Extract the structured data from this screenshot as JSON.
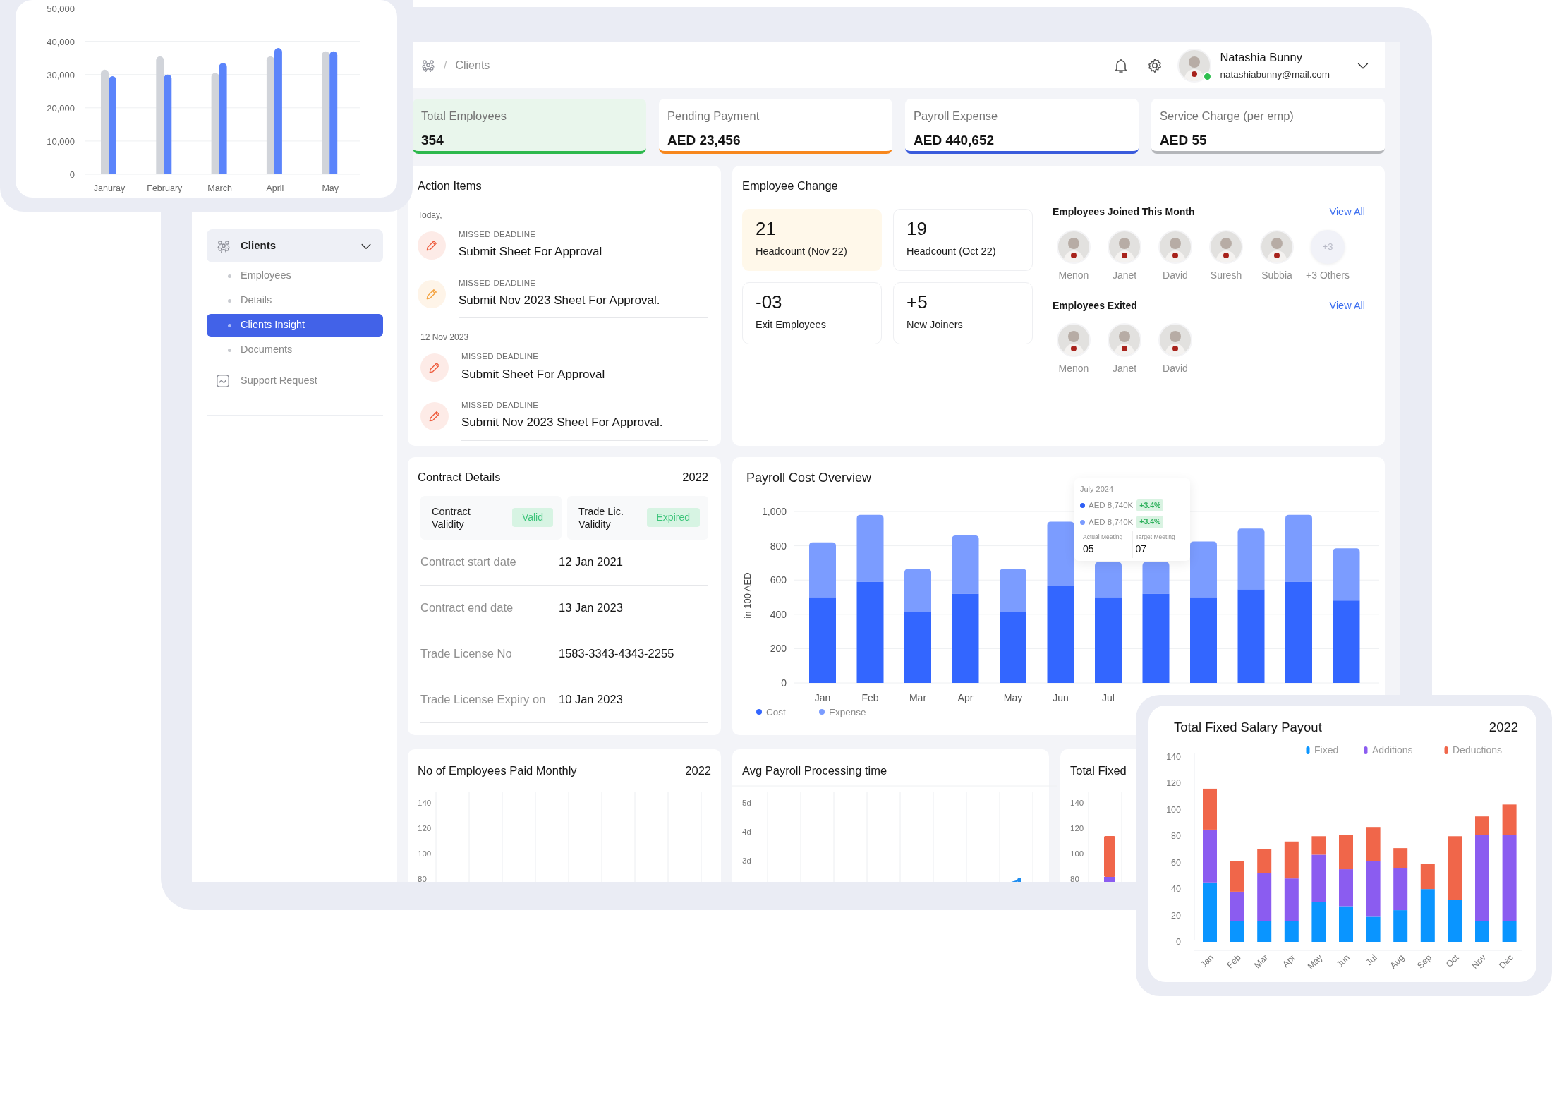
{
  "top_chart": {
    "chart_data": {
      "type": "bar",
      "categories": [
        "Januray",
        "February",
        "March",
        "April",
        "May"
      ],
      "series": [
        {
          "color": "#d1d4da",
          "values": [
            31500,
            35500,
            30500,
            35500,
            37000
          ]
        },
        {
          "color": "#5b84fb",
          "values": [
            29500,
            30000,
            33500,
            38000,
            37000
          ]
        }
      ],
      "ylim": [
        0,
        50000
      ],
      "grid": true,
      "yticks": [
        {
          "value": 0,
          "label": "0"
        },
        {
          "value": 10000,
          "label": "10,000"
        },
        {
          "value": 20000,
          "label": "20,000"
        },
        {
          "value": 30000,
          "label": "30,000"
        },
        {
          "value": 40000,
          "label": "40,000"
        },
        {
          "value": 50000,
          "label": "50,000"
        }
      ]
    }
  },
  "header": {
    "separator": "/",
    "current": "Clients",
    "user": {
      "name": "Natashia Bunny",
      "email": "natashiabunny@mail.com",
      "online": true
    }
  },
  "sidebar": {
    "items": [
      {
        "kind": "group",
        "label": "Clients",
        "expanded": true,
        "selected": false,
        "children": [
          {
            "label": "Employees",
            "selected": false
          },
          {
            "label": "Details",
            "selected": false
          },
          {
            "label": "Clients Insight",
            "selected": true
          },
          {
            "label": "Documents",
            "selected": false
          }
        ]
      },
      {
        "kind": "link",
        "label": "Support Request",
        "selected": false
      }
    ]
  },
  "stats": [
    {
      "label": "Total Employees",
      "value": "354",
      "color": "#2db84d",
      "selected": true
    },
    {
      "label": "Pending Payment",
      "value": "AED 23,456",
      "color": "#f7871d",
      "selected": false
    },
    {
      "label": "Payroll Expense",
      "value": "AED 440,652",
      "color": "#3a5bdc",
      "selected": false
    },
    {
      "label": "Service Charge (per emp)",
      "value": "AED 55",
      "color": "#b4b6ba",
      "selected": false
    }
  ],
  "action_items": {
    "title": "Action Items",
    "groups": [
      {
        "date": "Today,",
        "items": [
          {
            "tag": "MISSED DEADLINE",
            "title": "Submit Sheet For Approval",
            "color": "#ee5a3b"
          },
          {
            "tag": "MISSED DEADLINE",
            "title": "Submit Nov 2023 Sheet For Approval.",
            "color": "#f4a340"
          }
        ]
      },
      {
        "date": "12 Nov 2023",
        "items": [
          {
            "tag": "MISSED DEADLINE",
            "title": "Submit Sheet For Approval",
            "color": "#ee5a3b"
          },
          {
            "tag": "MISSED DEADLINE",
            "title": "Submit Nov 2023 Sheet For Approval.",
            "color": "#ee5a3b"
          }
        ]
      }
    ]
  },
  "employee_change": {
    "title": "Employee Change",
    "tiles": [
      {
        "value": "21",
        "label": "Headcount (Nov 22)",
        "selected": true
      },
      {
        "value": "19",
        "label": "Headcount (Oct 22)",
        "selected": false
      },
      {
        "value": "-03",
        "label": "Exit Employees",
        "selected": false
      },
      {
        "value": "+5",
        "label": "New Joiners",
        "selected": false
      }
    ],
    "joined": {
      "title": "Employees Joined This Month",
      "link": "View All",
      "people": [
        {
          "name": "Menon"
        },
        {
          "name": "Janet"
        },
        {
          "name": "David"
        },
        {
          "name": "Suresh"
        },
        {
          "name": "Subbia"
        }
      ],
      "more": {
        "count": "+3",
        "label": "+3 Others"
      }
    },
    "exited": {
      "title": "Employees Exited",
      "link": "View All",
      "people": [
        {
          "name": "Menon"
        },
        {
          "name": "Janet"
        },
        {
          "name": "David"
        }
      ]
    }
  },
  "contract": {
    "title": "Contract Details",
    "year": "2022",
    "validity": [
      {
        "label": "Contract Validity",
        "status": "Valid"
      },
      {
        "label": "Trade Lic. Validity",
        "status": "Expired"
      }
    ],
    "rows": [
      {
        "label": "Contract start date",
        "value": "12 Jan 2021"
      },
      {
        "label": "Contract end date",
        "value": "13 Jan 2023"
      },
      {
        "label": "Trade License No",
        "value": "1583-3343-4343-2255"
      },
      {
        "label": "Trade License Expiry on",
        "value": "10 Jan 2023"
      }
    ]
  },
  "payroll": {
    "title": "Payroll Cost Overview",
    "chart_data": {
      "type": "bar",
      "stacked": true,
      "ylabel": "in 100 AED",
      "categories": [
        "Jan",
        "Feb",
        "Mar",
        "Apr",
        "May",
        "Jun",
        "Jul",
        null,
        null,
        null,
        null,
        null
      ],
      "series": [
        {
          "name": "Cost",
          "color": "#3366ff",
          "values": [
            500,
            590,
            415,
            520,
            415,
            565,
            500,
            520,
            500,
            545,
            590,
            480
          ]
        },
        {
          "name": "Expense",
          "color": "#7b9cff",
          "values": [
            320,
            390,
            250,
            340,
            250,
            375,
            205,
            185,
            325,
            355,
            390,
            305
          ]
        }
      ],
      "ylim": [
        0,
        1000
      ],
      "grid": true,
      "legend": true,
      "yticks": [
        0,
        200,
        400,
        600,
        800,
        {
          "value": 1000,
          "label": "1,000"
        }
      ]
    },
    "tooltip": {
      "title": "July 2024",
      "rows": [
        {
          "value": "AED 8,740K",
          "change": "+3.4%",
          "color": "#2f5ff5"
        },
        {
          "value": "AED 8,740K",
          "change": "+3.4%",
          "color": "#7b9cff"
        }
      ],
      "stats": [
        {
          "label": "Actual Meeting",
          "value": "05"
        },
        {
          "label": "Target Meeting",
          "value": "07"
        }
      ]
    }
  },
  "bottom_cards": [
    {
      "kind": "empty",
      "title": "No of Employees Paid Monthly",
      "year": "2022",
      "y_axis_labels": [
        "140",
        "120",
        "100",
        "80"
      ]
    },
    {
      "kind": "line",
      "title": "Avg Payroll Processing time",
      "y_axis_labels": [
        "5d",
        "4d",
        "3d"
      ]
    },
    {
      "kind": "bar",
      "title": "Total Fixed",
      "y_axis_labels": [
        "140",
        "120",
        "100",
        "80"
      ]
    }
  ],
  "salary_chart": {
    "title": "Total Fixed Salary Payout",
    "year": "2022",
    "chart_data": {
      "type": "bar",
      "stacked": true,
      "categories": [
        "Jan",
        "Feb",
        "Mar",
        "Apr",
        "May",
        "Jun",
        "Jul",
        "Aug",
        "Sep",
        "Oct",
        "Nov",
        "Dec"
      ],
      "series": [
        {
          "name": "Fixed",
          "color": "#0a95ff",
          "values": [
            45,
            16,
            16,
            16,
            30,
            27,
            19,
            24,
            40,
            32,
            16,
            16
          ]
        },
        {
          "name": "Additions",
          "color": "#8b5cf0",
          "values": [
            40,
            22,
            36,
            32,
            36,
            28,
            42,
            32,
            0,
            0,
            65,
            65
          ]
        },
        {
          "name": "Deductions",
          "color": "#f0664a",
          "values": [
            31,
            23,
            18,
            28,
            14,
            26,
            26,
            15,
            19,
            48,
            14,
            23
          ]
        }
      ],
      "ylim": [
        0,
        140
      ],
      "legend": true,
      "yticks": [
        0,
        20,
        40,
        60,
        80,
        100,
        120,
        140
      ]
    }
  }
}
